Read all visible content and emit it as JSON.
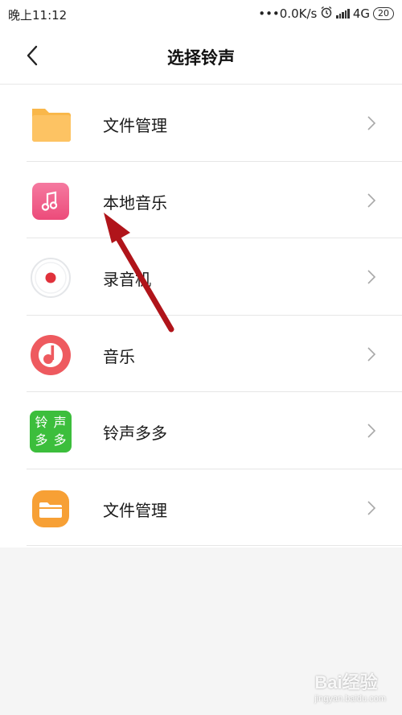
{
  "status_bar": {
    "time": "晚上11:12",
    "network_speed": "•••0.0K/s",
    "network_type": "4G",
    "battery": "20",
    "icons": [
      "alarm-icon",
      "signal-icon",
      "battery-icon"
    ]
  },
  "header": {
    "title": "选择铃声",
    "back_icon": "back-chevron-icon"
  },
  "list": {
    "items": [
      {
        "label": "文件管理",
        "icon": "folder-icon"
      },
      {
        "label": "本地音乐",
        "icon": "music-note-icon"
      },
      {
        "label": "录音机",
        "icon": "recorder-icon"
      },
      {
        "label": "音乐",
        "icon": "music-app-icon"
      },
      {
        "label": "铃声多多",
        "icon": "lingshengduoduo-icon",
        "icon_text": [
          "铃",
          "声",
          "多",
          "多"
        ]
      },
      {
        "label": "文件管理",
        "icon": "file-manager-icon"
      }
    ],
    "chevron_icon": "chevron-right-icon"
  },
  "annotation": {
    "arrow_color": "#b0141a"
  },
  "watermark": {
    "brand": "Bai经验",
    "url": "jingyan.baidu.com"
  }
}
